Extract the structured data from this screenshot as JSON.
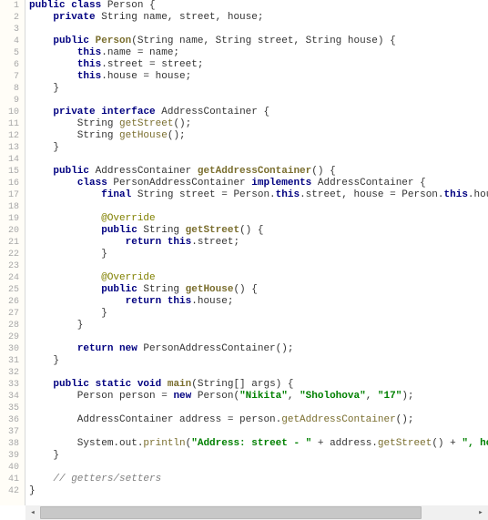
{
  "lines": [
    {
      "n": 1,
      "html": "<span class='kw'>public</span> <span class='kw'>class</span> Person {"
    },
    {
      "n": 2,
      "html": "    <span class='kw'>private</span> String name, street, house;"
    },
    {
      "n": 3,
      "html": ""
    },
    {
      "n": 4,
      "html": "    <span class='kw'>public</span> <span class='dcl'>Person</span>(String name, String street, String house) {"
    },
    {
      "n": 5,
      "html": "        <span class='kw'>this</span>.name = name;"
    },
    {
      "n": 6,
      "html": "        <span class='kw'>this</span>.street = street;"
    },
    {
      "n": 7,
      "html": "        <span class='kw'>this</span>.house = house;"
    },
    {
      "n": 8,
      "html": "    }"
    },
    {
      "n": 9,
      "html": ""
    },
    {
      "n": 10,
      "html": "    <span class='kw'>private</span> <span class='kw'>interface</span> AddressContainer {"
    },
    {
      "n": 11,
      "html": "        String <span class='mth'>getStreet</span>();"
    },
    {
      "n": 12,
      "html": "        String <span class='mth'>getHouse</span>();"
    },
    {
      "n": 13,
      "html": "    }"
    },
    {
      "n": 14,
      "html": ""
    },
    {
      "n": 15,
      "html": "    <span class='kw'>public</span> AddressContainer <span class='dcl'>getAddressContainer</span>() {"
    },
    {
      "n": 16,
      "html": "        <span class='kw'>class</span> PersonAddressContainer <span class='kw'>implements</span> AddressContainer {"
    },
    {
      "n": 17,
      "html": "            <span class='kw'>final</span> String street = Person.<span class='kw'>this</span>.street, house = Person.<span class='kw'>this</span>.house;"
    },
    {
      "n": 18,
      "html": ""
    },
    {
      "n": 19,
      "html": "            <span class='ann'>@Override</span>"
    },
    {
      "n": 20,
      "html": "            <span class='kw'>public</span> String <span class='dcl'>getStreet</span>() {"
    },
    {
      "n": 21,
      "html": "                <span class='kw'>return this</span>.street;"
    },
    {
      "n": 22,
      "html": "            }"
    },
    {
      "n": 23,
      "html": ""
    },
    {
      "n": 24,
      "html": "            <span class='ann'>@Override</span>"
    },
    {
      "n": 25,
      "html": "            <span class='kw'>public</span> String <span class='dcl'>getHouse</span>() {"
    },
    {
      "n": 26,
      "html": "                <span class='kw'>return this</span>.house;"
    },
    {
      "n": 27,
      "html": "            }"
    },
    {
      "n": 28,
      "html": "        }"
    },
    {
      "n": 29,
      "html": ""
    },
    {
      "n": 30,
      "html": "        <span class='kw'>return new</span> PersonAddressContainer();"
    },
    {
      "n": 31,
      "html": "    }"
    },
    {
      "n": 32,
      "html": ""
    },
    {
      "n": 33,
      "html": "    <span class='kw'>public static void</span> <span class='dcl'>main</span>(String[] args) {"
    },
    {
      "n": 34,
      "html": "        Person person = <span class='kw'>new</span> Person(<span class='str'>\"Nikita\"</span>, <span class='str'>\"Sholohova\"</span>, <span class='str'>\"17\"</span>);"
    },
    {
      "n": 35,
      "html": ""
    },
    {
      "n": 36,
      "html": "        AddressContainer address = person.<span class='mth'>getAddressContainer</span>();"
    },
    {
      "n": 37,
      "html": ""
    },
    {
      "n": 38,
      "html": "        System.out.<span class='mth'>println</span>(<span class='str'>\"Address: street - \"</span> + address.<span class='mth'>getStreet</span>() + <span class='str'>\", house - \"</span> + address.<span class='mth'>getHou</span>"
    },
    {
      "n": 39,
      "html": "    }"
    },
    {
      "n": 40,
      "html": ""
    },
    {
      "n": 41,
      "html": "    <span class='com'>// getters/setters</span>"
    },
    {
      "n": 42,
      "html": "}"
    }
  ],
  "arrows": {
    "left": "◂",
    "right": "▸"
  }
}
